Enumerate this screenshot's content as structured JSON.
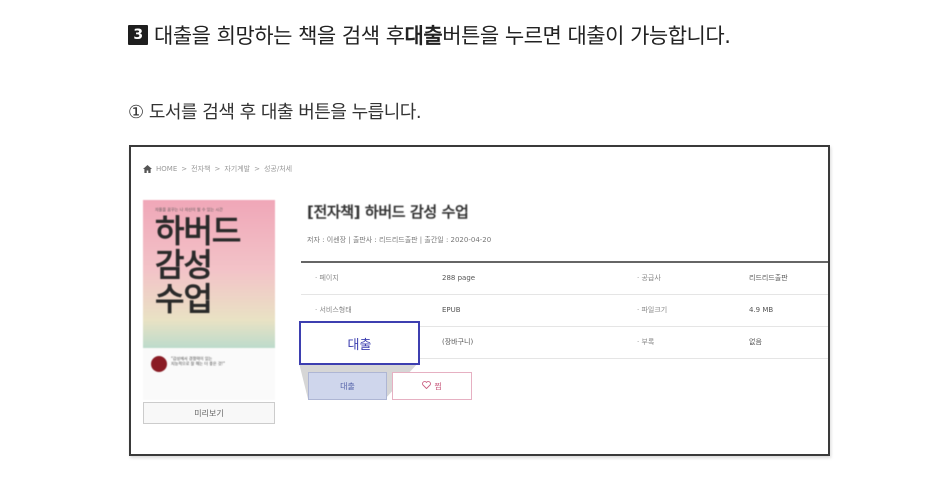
{
  "heading": {
    "step_number": "3",
    "text_before": "대출을 희망하는 책을 검색 후 ",
    "text_bold": "대출",
    "text_after": " 버튼을 누르면 대출이 가능합니다."
  },
  "subheading": "① 도서를 검색 후 대출 버튼을 누릅니다.",
  "breadcrumb": {
    "home_icon": "home-icon",
    "items": [
      "HOME",
      ">",
      "전자책",
      ">",
      "자기계발",
      ">",
      "성공/처세"
    ]
  },
  "book": {
    "cover": {
      "small_text": "자율을 꿈꾸는 나 자신이 될 수 있는 시간",
      "title_lines": [
        "하버드",
        "감성",
        "수업"
      ],
      "quote": "\"감성에서 경쟁력이 있는\n지능적으로 잘 해는 더 좋은 것!\""
    },
    "preview_label": "미리보기",
    "title": "[전자책] 하버드 감성 수업",
    "meta": "저자 : 이센장   |   출판사 : 리드리드출판   |   출간일 : 2020-04-20"
  },
  "info_rows": [
    [
      "· 페이지",
      "288 page",
      "· 공급사",
      "리드리드출판"
    ],
    [
      "· 서비스형태",
      "EPUB",
      "· 파일크기",
      "4.9 MB"
    ],
    [
      "",
      "(장바구니)",
      "· 부록",
      "없음"
    ]
  ],
  "buttons": {
    "borrow_callout": "대출",
    "borrow": "대출",
    "wish": "찜",
    "wish_icon": "heart-icon"
  },
  "colors": {
    "callout_border": "#3d3fb0",
    "wish_border": "#e6b0c2",
    "borrow_bg": "#cfd6ec"
  }
}
